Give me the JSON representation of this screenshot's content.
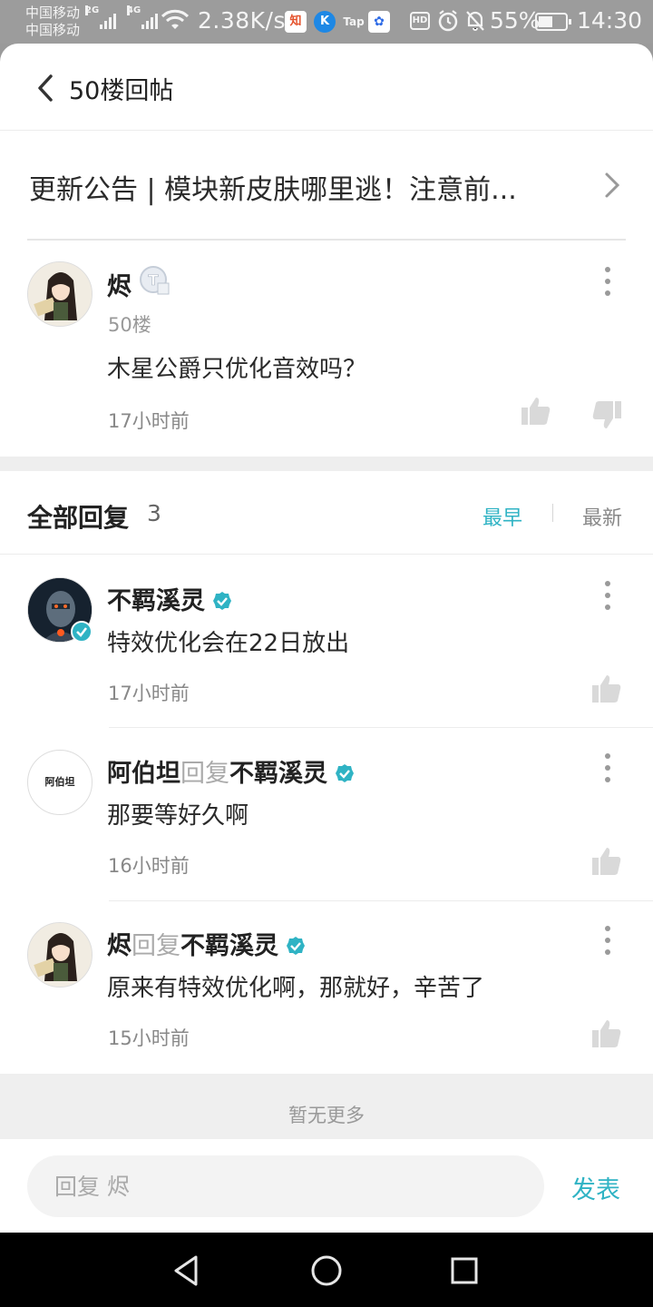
{
  "status_bar": {
    "carrier_1": "中国移动",
    "carrier_2": "中国移动",
    "gen_1": "2G",
    "gen_2": "4G",
    "net_speed": "2.38K/s",
    "app_icons": [
      "zhihu-icon",
      "kugou-icon",
      "taptap-icon",
      "baidu-icon"
    ],
    "hd_label": "HD",
    "battery_percent": "55%",
    "battery_level": 0.55,
    "time": "14:30"
  },
  "header": {
    "title": "50楼回帖"
  },
  "topic": {
    "title": "更新公告 | 模块新皮肤哪里逃！注意前..."
  },
  "main_post": {
    "author": "烬",
    "level_badge": "T",
    "floor": "50楼",
    "content": "木星公爵只优化音效吗？",
    "time": "17小时前"
  },
  "replies_header": {
    "title": "全部回复",
    "count": "3",
    "sort_earliest": "最早",
    "sort_latest": "最新"
  },
  "replies": [
    {
      "author": "不羁溪灵",
      "reply_word": "",
      "reply_to": "",
      "verified": true,
      "content": "特效优化会在22日放出",
      "time": "17小时前"
    },
    {
      "author": "阿伯坦",
      "reply_word": "回复",
      "reply_to": "不羁溪灵",
      "verified": true,
      "avatar_text": "阿伯坦",
      "content": "那要等好久啊",
      "time": "16小时前"
    },
    {
      "author": "烬",
      "reply_word": "回复",
      "reply_to": "不羁溪灵",
      "verified": true,
      "content": "原来有特效优化啊，那就好，辛苦了",
      "time": "15小时前"
    }
  ],
  "footer": {
    "no_more": "暂无更多",
    "input_placeholder": "回复 烬",
    "send_label": "发表"
  },
  "colors": {
    "accent": "#2fb3c4",
    "status_bar": "#9c9c9c"
  }
}
